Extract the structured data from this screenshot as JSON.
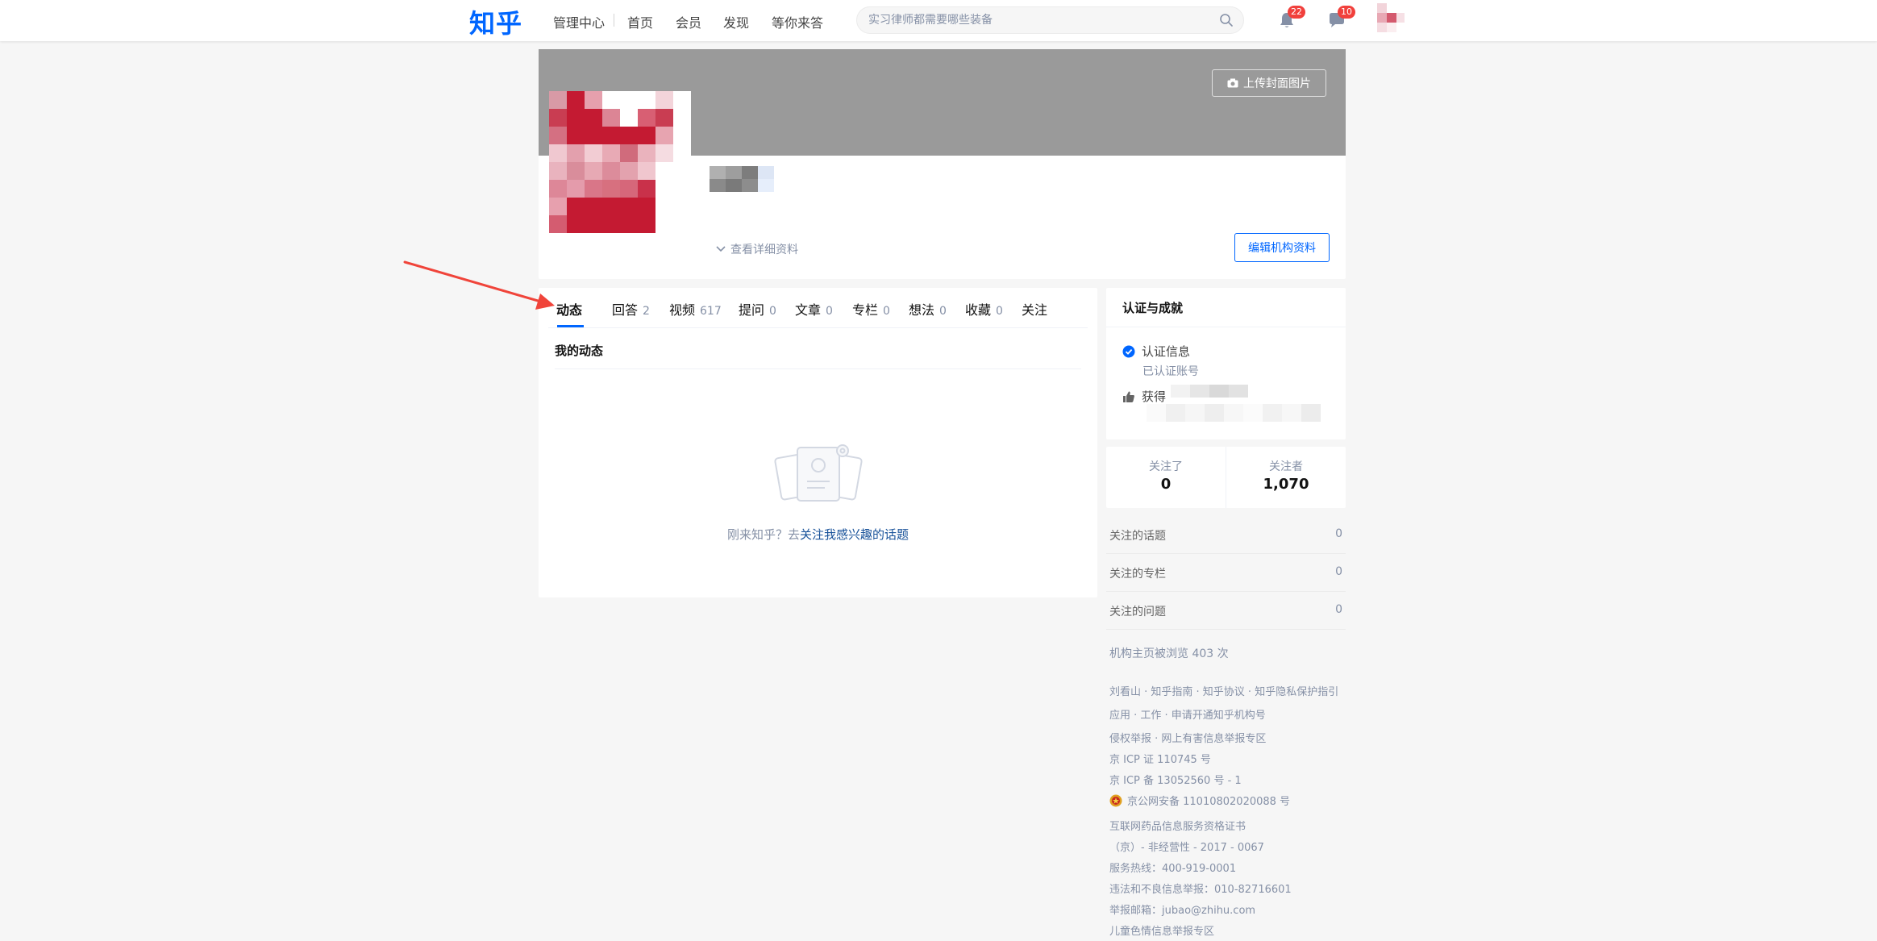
{
  "header": {
    "logo": "知乎",
    "nav": [
      "管理中心",
      "首页",
      "会员",
      "发现",
      "等你来答"
    ],
    "search_placeholder": "实习律师都需要哪些装备",
    "notifications_count": "22",
    "messages_count": "10"
  },
  "profile": {
    "upload_cover_label": "上传封面图片",
    "view_details_label": "查看详细资料",
    "edit_button_label": "编辑机构资料"
  },
  "tabs": [
    {
      "label": "动态",
      "count": ""
    },
    {
      "label": "回答",
      "count": "2"
    },
    {
      "label": "视频",
      "count": "617"
    },
    {
      "label": "提问",
      "count": "0"
    },
    {
      "label": "文章",
      "count": "0"
    },
    {
      "label": "专栏",
      "count": "0"
    },
    {
      "label": "想法",
      "count": "0"
    },
    {
      "label": "收藏",
      "count": "0"
    },
    {
      "label": "关注",
      "count": ""
    }
  ],
  "activity": {
    "title": "我的动态",
    "empty_prefix": "刚来知乎？去",
    "empty_link": "关注我感兴趣的话题"
  },
  "certification": {
    "title": "认证与成就",
    "item_label": "认证信息",
    "item_sub": "已认证账号",
    "like_label": "获得"
  },
  "follow": {
    "following_label": "关注了",
    "following_count": "0",
    "followers_label": "关注者",
    "followers_count": "1,070"
  },
  "stats": [
    {
      "label": "关注的话题",
      "value": "0"
    },
    {
      "label": "关注的专栏",
      "value": "0"
    },
    {
      "label": "关注的问题",
      "value": "0"
    }
  ],
  "views_text": "机构主页被浏览 403 次",
  "footer": [
    "刘看山 · 知乎指南 · 知乎协议 · 知乎隐私保护指引",
    "应用 · 工作 · 申请开通知乎机构号",
    "侵权举报 · 网上有害信息举报专区",
    "京 ICP 证 110745 号",
    "京 ICP 备 13052560 号 - 1",
    "京公网安备 11010802020088 号",
    "互联网药品信息服务资格证书",
    "（京）- 非经营性 - 2017 - 0067",
    "服务热线：400-919-0001",
    "违法和不良信息举报：010-82716601",
    "举报邮箱：jubao@zhihu.com",
    "儿童色情信息举报专区"
  ],
  "colors": {
    "brand": "#0066ff",
    "badge": "#f1403c",
    "annotation_arrow": "#f0443a"
  }
}
